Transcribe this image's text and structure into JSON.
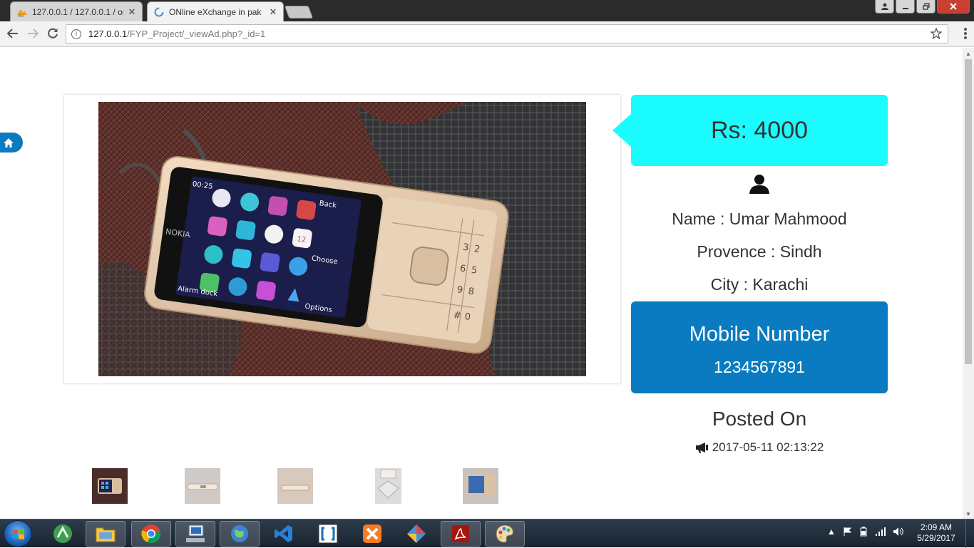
{
  "browser": {
    "tabs": [
      {
        "title": "127.0.0.1 / 127.0.0.1 / on",
        "close": "✕"
      },
      {
        "title": "ONline eXchange in pak",
        "close": "✕"
      }
    ],
    "url_host": "127.0.0.1",
    "url_path": "/FYP_Project/_viewAd.php?_id=1"
  },
  "ad": {
    "price": "Rs: 4000",
    "name_line": "Name : Umar Mahmood",
    "province_line": "Provence : Sindh",
    "city_line": "City : Karachi",
    "mobile_label": "Mobile Number",
    "mobile_number": "1234567891",
    "posted_label": "Posted On",
    "posted_date": "2017-05-11 02:13:22"
  },
  "phone_screen": {
    "time": "00:25",
    "brand": "NOKIA",
    "soft_left": "Options",
    "soft_middle": "Choose",
    "soft_right": "Back",
    "side_label": "Alarm dock",
    "calendar_day": "12"
  },
  "taskbar": {
    "time": "2:09 AM",
    "date": "5/29/2017"
  },
  "colors": {
    "price_bg": "#19fbfd",
    "mobile_bg": "#0a7bc0"
  }
}
